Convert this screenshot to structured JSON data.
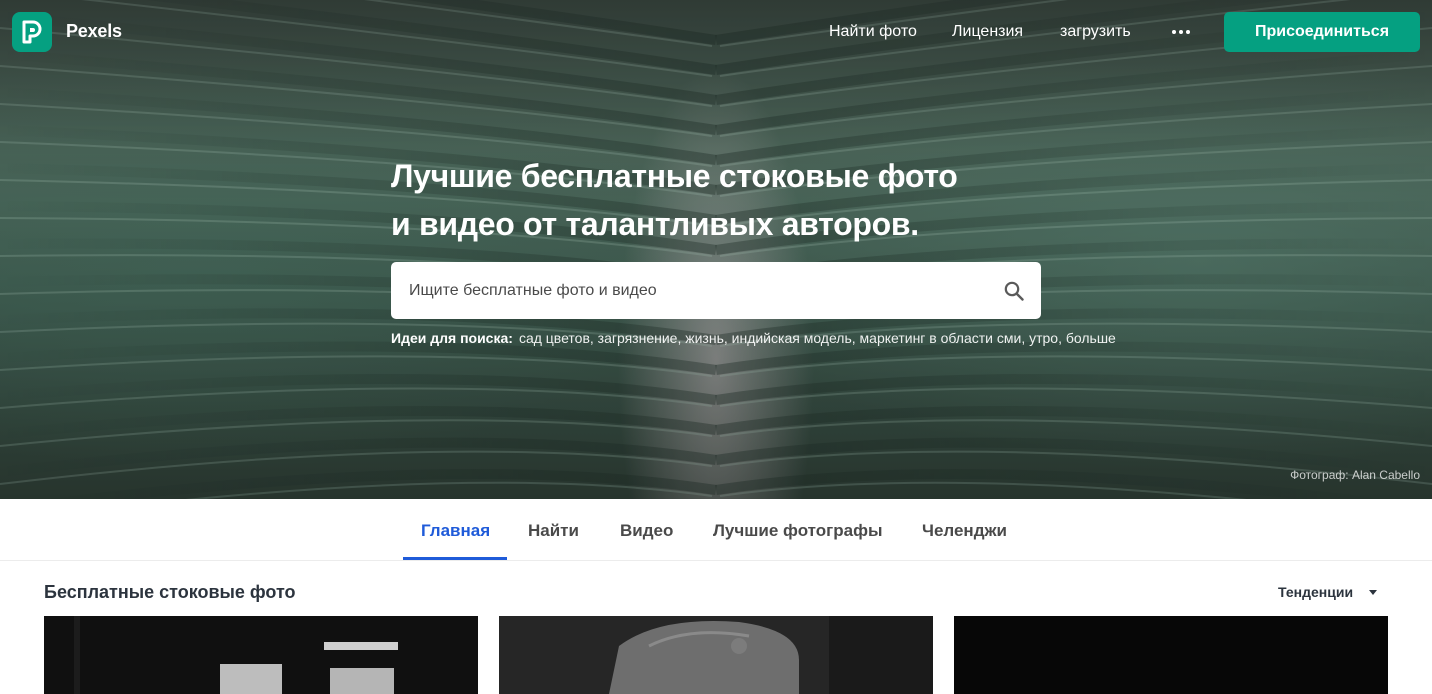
{
  "brand": {
    "name": "Pexels",
    "logo_icon": "pexels-logo-icon",
    "color": "#05a081"
  },
  "nav": {
    "links": [
      "Найти фото",
      "Лицензия",
      "загрузить"
    ],
    "more_icon": "ellipsis-icon",
    "join_label": "Присоединиться"
  },
  "hero": {
    "headline_line1": "Лучшие бесплатные стоковые фото",
    "headline_line2": "и видео от талантливых авторов.",
    "search_placeholder": "Ищите бесплатные фото и видео",
    "search_icon": "search-icon",
    "ideas_label": "Идеи для поиска:",
    "ideas": "сад цветов, загрязнение, жизнь, индийская модель, маркетинг в области сми, утро, больше",
    "credit": "Фотограф: Alan Cabello"
  },
  "tabs": {
    "items": [
      "Главная",
      "Найти",
      "Видео",
      "Лучшие фотографы",
      "Челенджи"
    ],
    "active": "Главная",
    "active_color": "#1f5bd9"
  },
  "section": {
    "title": "Бесплатные стоковые фото",
    "sort_label": "Тенденции",
    "sort_icon": "caret-down-icon"
  }
}
